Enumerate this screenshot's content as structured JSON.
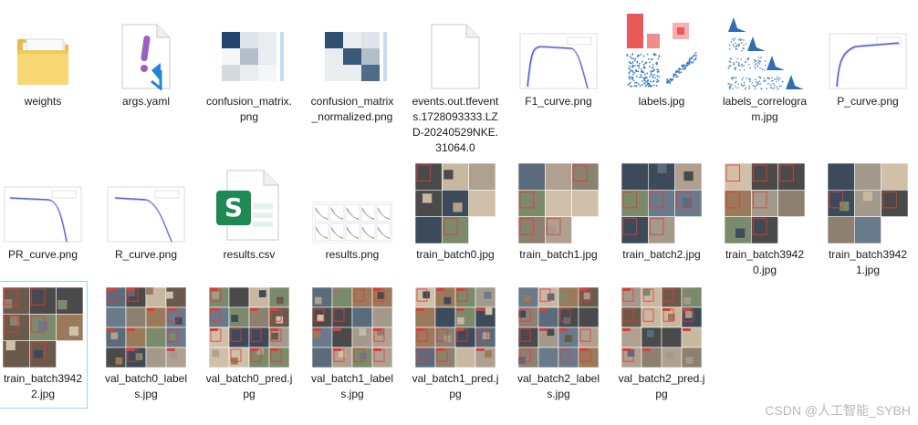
{
  "files": [
    {
      "name": "weights",
      "kind": "folder"
    },
    {
      "name": "args.yaml",
      "kind": "yaml"
    },
    {
      "name": "confusion_matrix.png",
      "kind": "cm"
    },
    {
      "name": "confusion_matrix_normalized.png",
      "kind": "cmn"
    },
    {
      "name": "events.out.tfevents.1728093333.LZD-20240529NKE.31064.0",
      "kind": "blank"
    },
    {
      "name": "F1_curve.png",
      "kind": "curve-f1"
    },
    {
      "name": "labels.jpg",
      "kind": "labels"
    },
    {
      "name": "labels_correlogram.jpg",
      "kind": "correlogram"
    },
    {
      "name": "P_curve.png",
      "kind": "curve-p"
    },
    {
      "name": "PR_curve.png",
      "kind": "curve-pr"
    },
    {
      "name": "R_curve.png",
      "kind": "curve-r"
    },
    {
      "name": "results.csv",
      "kind": "csv"
    },
    {
      "name": "results.png",
      "kind": "results"
    },
    {
      "name": "train_batch0.jpg",
      "kind": "batch"
    },
    {
      "name": "train_batch1.jpg",
      "kind": "batch"
    },
    {
      "name": "train_batch2.jpg",
      "kind": "batch"
    },
    {
      "name": "train_batch39420.jpg",
      "kind": "batch"
    },
    {
      "name": "train_batch39421.jpg",
      "kind": "batch"
    },
    {
      "name": "train_batch39422.jpg",
      "kind": "batch",
      "selected": true
    },
    {
      "name": "val_batch0_labels.jpg",
      "kind": "val"
    },
    {
      "name": "val_batch0_pred.jpg",
      "kind": "val"
    },
    {
      "name": "val_batch1_labels.jpg",
      "kind": "val"
    },
    {
      "name": "val_batch1_pred.jpg",
      "kind": "val"
    },
    {
      "name": "val_batch2_labels.jpg",
      "kind": "val"
    },
    {
      "name": "val_batch2_pred.jpg",
      "kind": "val"
    }
  ],
  "watermark": "CSDN @人工智能_SYBH",
  "colors": {
    "folder": "#f8d775",
    "cm": "#08306b",
    "curve": "#5b5bd6",
    "csv": "#1d8a55",
    "select": "#99d1ff"
  }
}
